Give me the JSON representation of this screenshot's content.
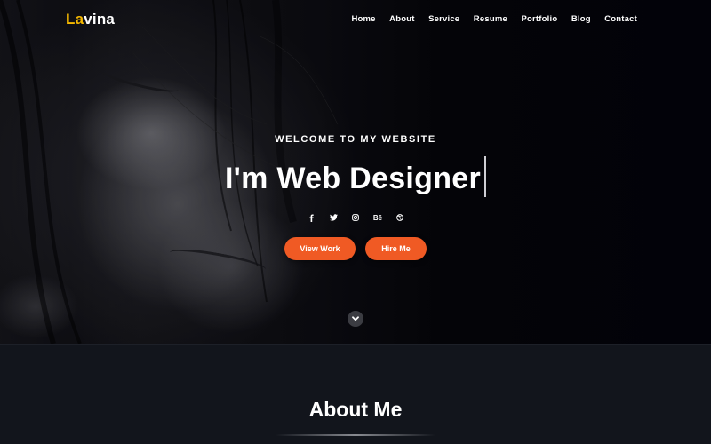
{
  "brand": {
    "logo_accent": "La",
    "logo_rest": "vina",
    "accent_color": "#f5b800"
  },
  "nav": {
    "items": [
      {
        "label": "Home"
      },
      {
        "label": "About"
      },
      {
        "label": "Service"
      },
      {
        "label": "Resume"
      },
      {
        "label": "Portfolio"
      },
      {
        "label": "Blog"
      },
      {
        "label": "Contact"
      }
    ]
  },
  "hero": {
    "welcome": "WELCOME TO MY WEBSITE",
    "headline": "I'm Web Designer",
    "socials": [
      {
        "icon": "facebook-icon",
        "glyph": "f"
      },
      {
        "icon": "twitter-icon",
        "glyph": ""
      },
      {
        "icon": "instagram-icon",
        "glyph": ""
      },
      {
        "icon": "behance-icon",
        "glyph": "Bē"
      },
      {
        "icon": "dribbble-icon",
        "glyph": ""
      }
    ],
    "buttons": {
      "view_work": "View Work",
      "hire_me": "Hire Me",
      "color": "#f05a24"
    },
    "scroll_icon": "chevron-down-icon"
  },
  "about": {
    "title": "About Me"
  }
}
